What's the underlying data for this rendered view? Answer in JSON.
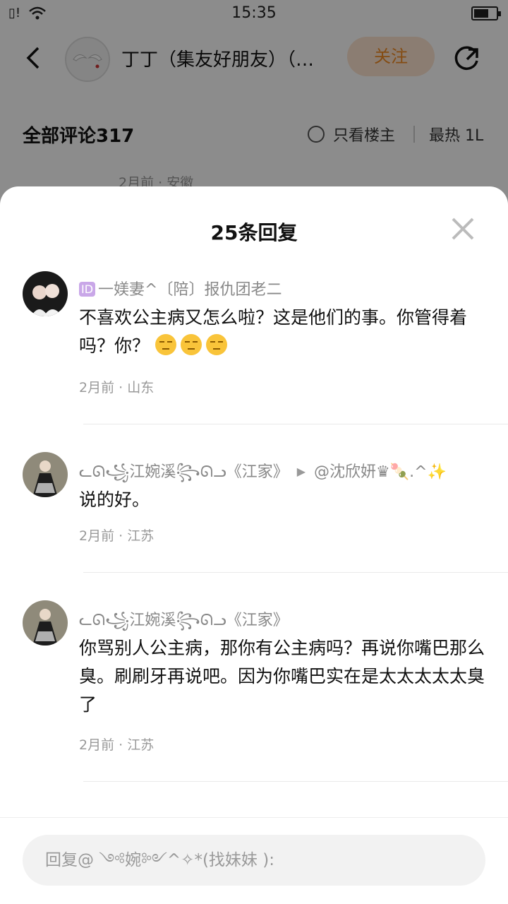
{
  "status": {
    "time": "15:35",
    "battery_percent": 60
  },
  "header": {
    "title": "丁丁（集友好朋友）（…",
    "follow_label": "关注"
  },
  "comments": {
    "title": "全部评论317",
    "only_owner_label": "只看楼主",
    "sort_label": "最热 1L",
    "first_meta": "2月前 · 安徽"
  },
  "sheet": {
    "title": "25条回复",
    "replies": [
      {
        "badge": "ID",
        "name": "一媄妻^〔陪〕报仇团老二",
        "reply_to": "",
        "text": "不喜欢公主病又怎么啦？这是他们的事。你管得着吗？你？",
        "emoji_count": 3,
        "meta": "2月前 · 山东"
      },
      {
        "badge": "",
        "name": "ᓚᘏ꧁江婉溪꧂ᘏᓗ《江家》",
        "reply_to": "@沈欣妍♛🍡.^✨",
        "text": "说的好。",
        "meta": "2月前 · 江苏"
      },
      {
        "badge": "",
        "name": "ᓚᘏ꧁江婉溪꧂ᘏᓗ《江家》",
        "reply_to": "",
        "text": "你骂别人公主病，那你有公主病吗？再说你嘴巴那么臭。刷刷牙再说吧。因为你嘴巴实在是太太太太太臭了",
        "meta": "2月前 · 江苏"
      }
    ]
  },
  "input": {
    "placeholder": "回复@ ༺婉༻^✧*(找妹妹 ):"
  }
}
